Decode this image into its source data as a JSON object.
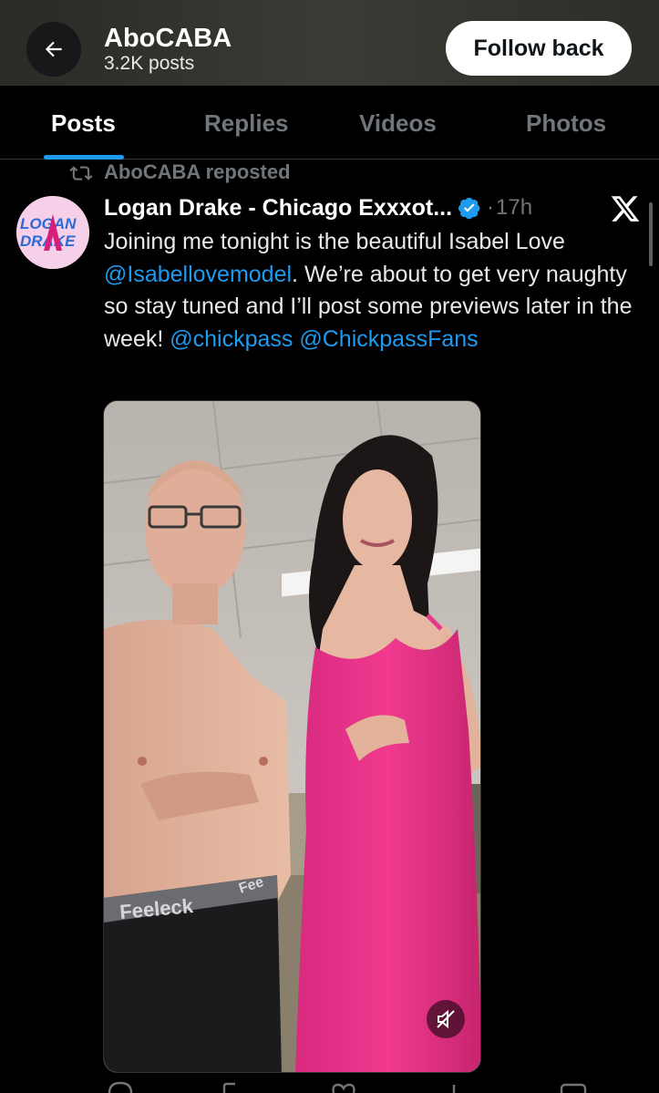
{
  "header": {
    "title": "AboCABA",
    "subtitle": "3.2K posts",
    "follow_label": "Follow back"
  },
  "tabs": [
    {
      "label": "Posts",
      "active": true
    },
    {
      "label": "Replies",
      "active": false
    },
    {
      "label": "Videos",
      "active": false
    },
    {
      "label": "Photos",
      "active": false
    }
  ],
  "post": {
    "repost_label": "AboCABA reposted",
    "author_name": "Logan Drake - Chicago Exxxot...",
    "verified": true,
    "separator": "·",
    "time": "17h",
    "avatar_text": "LOGAN DRAKE",
    "text_parts": [
      "Joining me tonight is the beautiful Isabel Love ",
      "@Isabellovemodel",
      ".  We’re about to get very naughty so stay tuned and I’ll post some previews later in the week!  ",
      "@chickpass",
      " ",
      "@ChickpassFans"
    ],
    "media_overlay_text": {
      "waistband_1": "Feeleck",
      "waistband_2": "Fee"
    }
  },
  "icons": {
    "back": "arrow-left-icon",
    "repost": "repost-icon",
    "verified": "verified-badge-icon",
    "x_logo": "x-logo-icon",
    "mute": "muted-speaker-icon"
  },
  "colors": {
    "accent": "#1d9bf0",
    "muted_text": "#71767b",
    "background": "#000000",
    "dress_pink": "#ea2f8c"
  }
}
